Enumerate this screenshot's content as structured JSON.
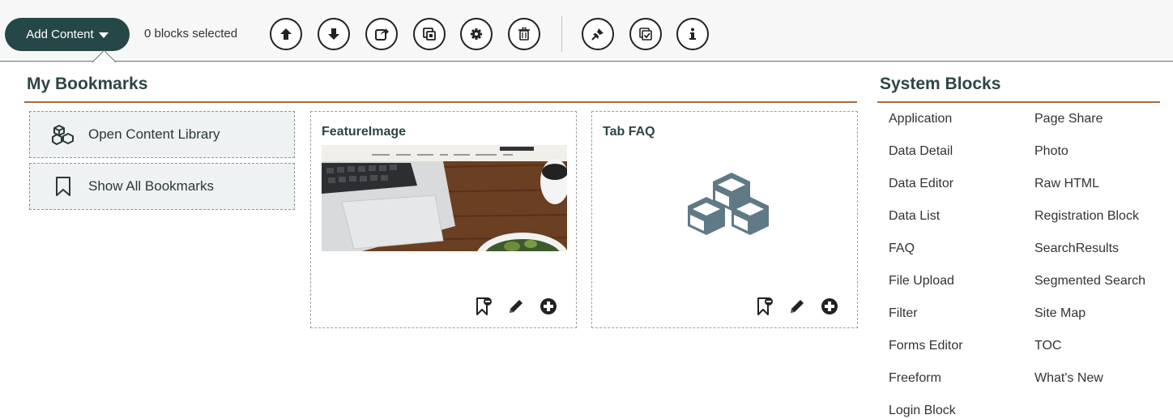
{
  "toolbar": {
    "add_content_label": "Add Content",
    "selected_count": "0 blocks selected",
    "icons": [
      "arrow-up-icon",
      "arrow-down-icon",
      "share-icon",
      "copy-icon",
      "gear-icon",
      "trash-icon",
      "unpin-icon",
      "checkbox-icon",
      "info-icon"
    ]
  },
  "bookmarks": {
    "title": "My Bookmarks",
    "actions": [
      {
        "label": "Open Content Library",
        "icon": "cubes-icon"
      },
      {
        "label": "Show All Bookmarks",
        "icon": "bookmark-icon"
      }
    ],
    "cards": [
      {
        "title": "FeatureImage"
      },
      {
        "title": "Tab FAQ"
      }
    ]
  },
  "system_blocks": {
    "title": "System Blocks",
    "left": [
      "Application",
      "Data Detail",
      "Data Editor",
      "Data List",
      "FAQ",
      "File Upload",
      "Filter",
      "Forms Editor",
      "Freeform",
      "Login Block"
    ],
    "right": [
      "Page Share",
      "Photo",
      "Raw HTML",
      "Registration Block",
      "SearchResults",
      "Segmented Search",
      "Site Map",
      "TOC",
      "What's New"
    ]
  },
  "colors": {
    "accent_dark": "#264747",
    "section_line": "#a86a3e",
    "icon_fill": "#5f7a86"
  }
}
